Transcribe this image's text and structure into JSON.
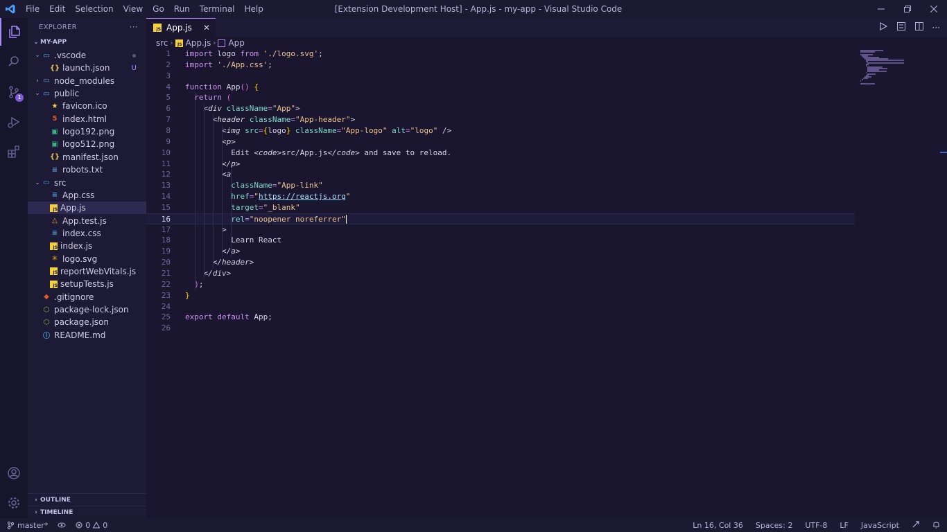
{
  "titlebar": {
    "menus": [
      "File",
      "Edit",
      "Selection",
      "View",
      "Go",
      "Run",
      "Terminal",
      "Help"
    ],
    "window_title": "[Extension Development Host] - App.js - my-app - Visual Studio Code"
  },
  "activity": {
    "scm_badge": "1"
  },
  "sidebar": {
    "title": "EXPLORER",
    "more": "···",
    "root": "MY-APP",
    "items": [
      {
        "label": ".vscode",
        "type": "folder-open"
      },
      {
        "label": "launch.json",
        "type": "json",
        "badge": "U"
      },
      {
        "label": "node_modules",
        "type": "folder"
      },
      {
        "label": "public",
        "type": "folder-open"
      },
      {
        "label": "favicon.ico",
        "type": "ico"
      },
      {
        "label": "index.html",
        "type": "html"
      },
      {
        "label": "logo192.png",
        "type": "png"
      },
      {
        "label": "logo512.png",
        "type": "png"
      },
      {
        "label": "manifest.json",
        "type": "json"
      },
      {
        "label": "robots.txt",
        "type": "txt"
      },
      {
        "label": "src",
        "type": "folder-open"
      },
      {
        "label": "App.css",
        "type": "css"
      },
      {
        "label": "App.js",
        "type": "js"
      },
      {
        "label": "App.test.js",
        "type": "test"
      },
      {
        "label": "index.css",
        "type": "css"
      },
      {
        "label": "index.js",
        "type": "js"
      },
      {
        "label": "logo.svg",
        "type": "svg"
      },
      {
        "label": "reportWebVitals.js",
        "type": "js"
      },
      {
        "label": "setupTests.js",
        "type": "js"
      },
      {
        "label": ".gitignore",
        "type": "git"
      },
      {
        "label": "package-lock.json",
        "type": "npm"
      },
      {
        "label": "package.json",
        "type": "npm"
      },
      {
        "label": "README.md",
        "type": "info"
      }
    ],
    "outline": "OUTLINE",
    "timeline": "TIMELINE"
  },
  "editor": {
    "tab_label": "App.js",
    "tab_js": "JS",
    "tab_close": "✕",
    "breadcrumb": [
      "src",
      "App.js",
      "App"
    ],
    "code_lines": [
      "import logo from './logo.svg';",
      "import './App.css';",
      "",
      "function App() {",
      "  return (",
      "    <div className=\"App\">",
      "      <header className=\"App-header\">",
      "        <img src={logo} className=\"App-logo\" alt=\"logo\" />",
      "        <p>",
      "          Edit <code>src/App.js</code> and save to reload.",
      "        </p>",
      "        <a",
      "          className=\"App-link\"",
      "          href=\"https://reactjs.org\"",
      "          target=\"_blank\"",
      "          rel=\"noopener noreferrer\"",
      "        >",
      "          Learn React",
      "        </a>",
      "      </header>",
      "    </div>",
      "  );",
      "}",
      "",
      "export default App;",
      ""
    ],
    "current_line": 16
  },
  "statusbar": {
    "branch": "master*",
    "errors": "0",
    "warnings": "0",
    "position": "Ln 16, Col 36",
    "spaces": "Spaces: 2",
    "encoding": "UTF-8",
    "eol": "LF",
    "language": "JavaScript"
  }
}
